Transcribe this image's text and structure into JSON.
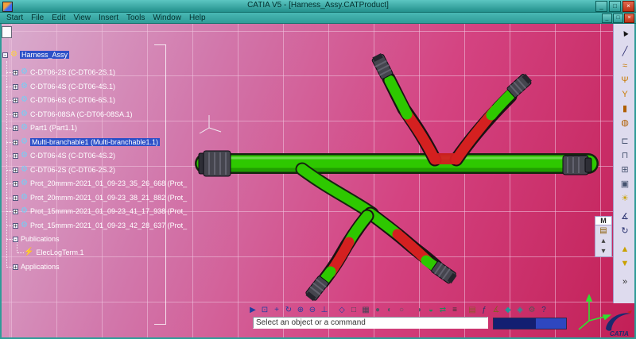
{
  "window": {
    "title": "CATIA V5 - [Harness_Assy.CATProduct]",
    "buttons": [
      {
        "name": "minimize",
        "glyph": "_"
      },
      {
        "name": "maximize",
        "glyph": "□"
      },
      {
        "name": "close",
        "glyph": "×"
      }
    ],
    "doc_buttons": [
      {
        "name": "doc-minimize",
        "glyph": "_"
      },
      {
        "name": "doc-restore",
        "glyph": "□"
      },
      {
        "name": "doc-close",
        "glyph": "×"
      }
    ]
  },
  "menu": {
    "items": [
      "Start",
      "File",
      "Edit",
      "View",
      "Insert",
      "Tools",
      "Window",
      "Help"
    ]
  },
  "tree": {
    "root": "Harness_Assy",
    "root_icon": "⚙",
    "node_plus": "+",
    "node_minus": "-",
    "icon": "⚙",
    "icon_color": "#6fd0f7",
    "items": [
      {
        "label": "C-DT06-2S (C-DT06-2S.1)"
      },
      {
        "label": "C-DT06-4S (C-DT06-4S.1)"
      },
      {
        "label": "C-DT06-6S (C-DT06-6S.1)"
      },
      {
        "label": "C-DT06-08SA (C-DT06-08SA.1)"
      },
      {
        "label": "Part1 (Part1.1)"
      },
      {
        "label": "Multi-branchable1 (Multi-branchable1.1)",
        "selected": true
      },
      {
        "label": "C-DT06-4S (C-DT06-4S.2)"
      },
      {
        "label": "C-DT06-2S (C-DT06-2S.2)"
      },
      {
        "label": "Prot_20mmm-2021_01_09-23_35_26_668 (Prot_"
      },
      {
        "label": "Prot_20mmm-2021_01_09-23_38_21_882 (Prot_"
      },
      {
        "label": "Prot_15mmm-2021_01_09-23_41_17_938 (Prot_"
      },
      {
        "label": "Prot_15mmm-2021_01_09-23_42_28_637 (Prot_"
      }
    ],
    "publications": "Publications",
    "publication_child": "ElecLogTerm.1",
    "publication_child_icon": "⚡",
    "applications": "Applications"
  },
  "sidebar": {
    "icons": [
      {
        "name": "select-arrow",
        "glyph": "▲",
        "color": "#151515",
        "rotate": -30
      },
      {
        "name": "sketch-line",
        "glyph": "╱",
        "color": "#2c2c6e",
        "gap": true
      },
      {
        "name": "bundle-segment",
        "glyph": "≈",
        "color": "#c97a00"
      },
      {
        "name": "multi-branchable",
        "glyph": "Ψ",
        "color": "#c97a00"
      },
      {
        "name": "branch-point",
        "glyph": "Y",
        "color": "#c97a00"
      },
      {
        "name": "protective-covering",
        "glyph": "▮",
        "color": "#b05f00"
      },
      {
        "name": "adaptive-tape",
        "glyph": "◍",
        "color": "#b05f00"
      },
      {
        "name": "connector-device",
        "glyph": "⊏",
        "color": "#44516e",
        "gap": true
      },
      {
        "name": "support-device",
        "glyph": "⊓",
        "color": "#44516e"
      },
      {
        "name": "electrical-junction",
        "glyph": "⊞",
        "color": "#44516e"
      },
      {
        "name": "camera-view",
        "glyph": "▣",
        "color": "#44516e"
      },
      {
        "name": "light-source",
        "glyph": "☀",
        "color": "#c9a100"
      },
      {
        "name": "measure-item",
        "glyph": "∡",
        "color": "#28306e",
        "gap": true
      },
      {
        "name": "update-all",
        "glyph": "↻",
        "color": "#28306e"
      },
      {
        "name": "reorder-up",
        "glyph": "▲",
        "color": "#c9a100",
        "gap": true
      },
      {
        "name": "reorder-down",
        "glyph": "▼",
        "color": "#c9a100"
      },
      {
        "name": "toolbar-overflow",
        "glyph": "»",
        "color": "#333",
        "gap": true
      }
    ]
  },
  "side_panel": {
    "label": "M",
    "icons": [
      {
        "name": "catalog-browser",
        "glyph": "▤",
        "color": "#8a5a00"
      },
      {
        "name": "scroll-up",
        "glyph": "▴",
        "color": "#444"
      },
      {
        "name": "scroll-down",
        "glyph": "▾",
        "color": "#444"
      }
    ]
  },
  "bottom_toolbar": {
    "icons": [
      {
        "name": "fly-mode",
        "glyph": "▶",
        "color": "#203e9e"
      },
      {
        "name": "fit-all-in",
        "glyph": "⊡",
        "color": "#203e9e"
      },
      {
        "name": "pan",
        "glyph": "+",
        "color": "#203e9e"
      },
      {
        "name": "rotate",
        "glyph": "↻",
        "color": "#203e9e"
      },
      {
        "name": "zoom-in",
        "glyph": "⊕",
        "color": "#203e9e"
      },
      {
        "name": "zoom-out",
        "glyph": "⊖",
        "color": "#203e9e"
      },
      {
        "name": "normal-view",
        "glyph": "⊥",
        "color": "#203e9e"
      },
      {
        "name": "iso-view",
        "glyph": "◇",
        "color": "#203e9e",
        "gap": true
      },
      {
        "name": "front-view",
        "glyph": "□",
        "color": "#445"
      },
      {
        "name": "multi-view",
        "glyph": "▦",
        "color": "#445"
      },
      {
        "name": "shaded-view",
        "glyph": "●",
        "color": "#556"
      },
      {
        "name": "shaded-edges-view",
        "glyph": "◐",
        "color": "#556"
      },
      {
        "name": "wireframe-view",
        "glyph": "○",
        "color": "#556"
      },
      {
        "name": "render-style",
        "glyph": "◑",
        "color": "#556",
        "gap": true
      },
      {
        "name": "hide-show",
        "glyph": "◒",
        "color": "#1e8a5a"
      },
      {
        "name": "swap-visible-space",
        "glyph": "⇄",
        "color": "#1e8a5a"
      },
      {
        "name": "graph-tree",
        "glyph": "≡",
        "color": "#333"
      },
      {
        "name": "catalog",
        "glyph": "▤",
        "color": "#8a5a2a",
        "gap": true
      },
      {
        "name": "knowledge-formula",
        "glyph": "ƒ",
        "color": "#24366e"
      },
      {
        "name": "measure-between",
        "glyph": "∡",
        "color": "#8a5a2a"
      },
      {
        "name": "apply-material",
        "glyph": "◆",
        "color": "#1e9a9a"
      },
      {
        "name": "sectioning",
        "glyph": "◈",
        "color": "#1e9a9a"
      },
      {
        "name": "settings",
        "glyph": "⚙",
        "color": "#555"
      },
      {
        "name": "what-is-this",
        "glyph": "?",
        "color": "#24366e"
      }
    ]
  },
  "status": {
    "prompt": "Select an object or a command"
  },
  "logo": {
    "text": "CATIA"
  },
  "colors": {
    "green": "#2ec800",
    "red": "#d42020",
    "connector": "#45454e",
    "highlight": "#2d50c8",
    "vp1": "#d9aecf",
    "vp2": "#d277ab",
    "vp3": "#d44381",
    "vp4": "#c21f56",
    "tb1": "#5cc6c2",
    "tb2": "#23908c",
    "grid": "rgba(240,198,224,0.55)",
    "sidebar_bg": "#dedbee"
  }
}
